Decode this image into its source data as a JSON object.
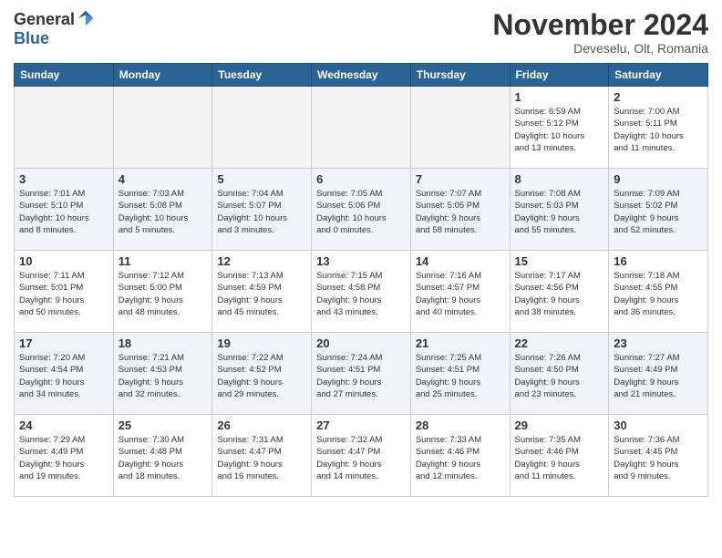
{
  "logo": {
    "general": "General",
    "blue": "Blue"
  },
  "title": "November 2024",
  "subtitle": "Deveselu, Olt, Romania",
  "headers": [
    "Sunday",
    "Monday",
    "Tuesday",
    "Wednesday",
    "Thursday",
    "Friday",
    "Saturday"
  ],
  "weeks": [
    [
      {
        "day": "",
        "info": ""
      },
      {
        "day": "",
        "info": ""
      },
      {
        "day": "",
        "info": ""
      },
      {
        "day": "",
        "info": ""
      },
      {
        "day": "",
        "info": ""
      },
      {
        "day": "1",
        "info": "Sunrise: 6:59 AM\nSunset: 5:12 PM\nDaylight: 10 hours\nand 13 minutes."
      },
      {
        "day": "2",
        "info": "Sunrise: 7:00 AM\nSunset: 5:11 PM\nDaylight: 10 hours\nand 11 minutes."
      }
    ],
    [
      {
        "day": "3",
        "info": "Sunrise: 7:01 AM\nSunset: 5:10 PM\nDaylight: 10 hours\nand 8 minutes."
      },
      {
        "day": "4",
        "info": "Sunrise: 7:03 AM\nSunset: 5:08 PM\nDaylight: 10 hours\nand 5 minutes."
      },
      {
        "day": "5",
        "info": "Sunrise: 7:04 AM\nSunset: 5:07 PM\nDaylight: 10 hours\nand 3 minutes."
      },
      {
        "day": "6",
        "info": "Sunrise: 7:05 AM\nSunset: 5:06 PM\nDaylight: 10 hours\nand 0 minutes."
      },
      {
        "day": "7",
        "info": "Sunrise: 7:07 AM\nSunset: 5:05 PM\nDaylight: 9 hours\nand 58 minutes."
      },
      {
        "day": "8",
        "info": "Sunrise: 7:08 AM\nSunset: 5:03 PM\nDaylight: 9 hours\nand 55 minutes."
      },
      {
        "day": "9",
        "info": "Sunrise: 7:09 AM\nSunset: 5:02 PM\nDaylight: 9 hours\nand 52 minutes."
      }
    ],
    [
      {
        "day": "10",
        "info": "Sunrise: 7:11 AM\nSunset: 5:01 PM\nDaylight: 9 hours\nand 50 minutes."
      },
      {
        "day": "11",
        "info": "Sunrise: 7:12 AM\nSunset: 5:00 PM\nDaylight: 9 hours\nand 48 minutes."
      },
      {
        "day": "12",
        "info": "Sunrise: 7:13 AM\nSunset: 4:59 PM\nDaylight: 9 hours\nand 45 minutes."
      },
      {
        "day": "13",
        "info": "Sunrise: 7:15 AM\nSunset: 4:58 PM\nDaylight: 9 hours\nand 43 minutes."
      },
      {
        "day": "14",
        "info": "Sunrise: 7:16 AM\nSunset: 4:57 PM\nDaylight: 9 hours\nand 40 minutes."
      },
      {
        "day": "15",
        "info": "Sunrise: 7:17 AM\nSunset: 4:56 PM\nDaylight: 9 hours\nand 38 minutes."
      },
      {
        "day": "16",
        "info": "Sunrise: 7:18 AM\nSunset: 4:55 PM\nDaylight: 9 hours\nand 36 minutes."
      }
    ],
    [
      {
        "day": "17",
        "info": "Sunrise: 7:20 AM\nSunset: 4:54 PM\nDaylight: 9 hours\nand 34 minutes."
      },
      {
        "day": "18",
        "info": "Sunrise: 7:21 AM\nSunset: 4:53 PM\nDaylight: 9 hours\nand 32 minutes."
      },
      {
        "day": "19",
        "info": "Sunrise: 7:22 AM\nSunset: 4:52 PM\nDaylight: 9 hours\nand 29 minutes."
      },
      {
        "day": "20",
        "info": "Sunrise: 7:24 AM\nSunset: 4:51 PM\nDaylight: 9 hours\nand 27 minutes."
      },
      {
        "day": "21",
        "info": "Sunrise: 7:25 AM\nSunset: 4:51 PM\nDaylight: 9 hours\nand 25 minutes."
      },
      {
        "day": "22",
        "info": "Sunrise: 7:26 AM\nSunset: 4:50 PM\nDaylight: 9 hours\nand 23 minutes."
      },
      {
        "day": "23",
        "info": "Sunrise: 7:27 AM\nSunset: 4:49 PM\nDaylight: 9 hours\nand 21 minutes."
      }
    ],
    [
      {
        "day": "24",
        "info": "Sunrise: 7:29 AM\nSunset: 4:49 PM\nDaylight: 9 hours\nand 19 minutes."
      },
      {
        "day": "25",
        "info": "Sunrise: 7:30 AM\nSunset: 4:48 PM\nDaylight: 9 hours\nand 18 minutes."
      },
      {
        "day": "26",
        "info": "Sunrise: 7:31 AM\nSunset: 4:47 PM\nDaylight: 9 hours\nand 16 minutes."
      },
      {
        "day": "27",
        "info": "Sunrise: 7:32 AM\nSunset: 4:47 PM\nDaylight: 9 hours\nand 14 minutes."
      },
      {
        "day": "28",
        "info": "Sunrise: 7:33 AM\nSunset: 4:46 PM\nDaylight: 9 hours\nand 12 minutes."
      },
      {
        "day": "29",
        "info": "Sunrise: 7:35 AM\nSunset: 4:46 PM\nDaylight: 9 hours\nand 11 minutes."
      },
      {
        "day": "30",
        "info": "Sunrise: 7:36 AM\nSunset: 4:45 PM\nDaylight: 9 hours\nand 9 minutes."
      }
    ]
  ]
}
